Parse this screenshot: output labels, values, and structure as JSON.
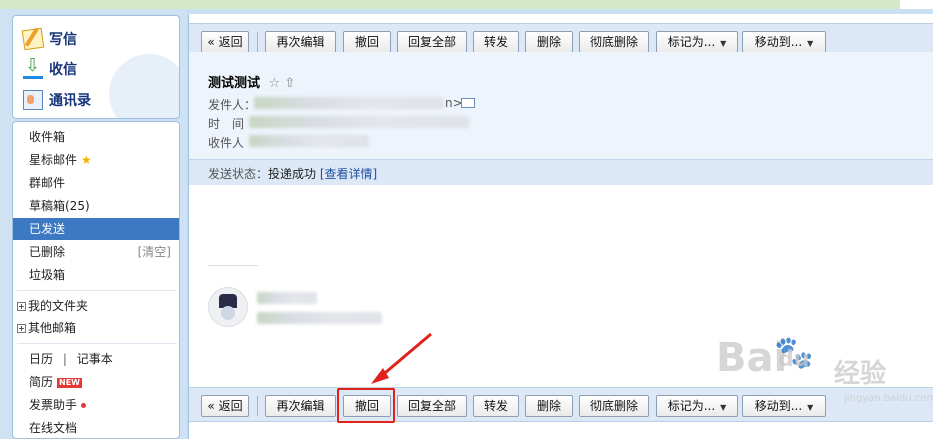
{
  "sidebar": {
    "compose": [
      {
        "label": "写信",
        "icon": "pencil-icon"
      },
      {
        "label": "收信",
        "icon": "inbox-download-icon"
      },
      {
        "label": "通讯录",
        "icon": "address-book-icon"
      }
    ],
    "folders": {
      "inbox": "收件箱",
      "starred": "星标邮件",
      "group": "群邮件",
      "drafts": "草稿箱(25)",
      "sent": "已发送",
      "deleted": "已删除",
      "deleted_action": "[清空]",
      "spam": "垃圾箱",
      "my_folders": "我的文件夹",
      "other_mailboxes": "其他邮箱",
      "calendar": "日历",
      "calendar_sep": "|",
      "notes": "记事本",
      "resume": "简历",
      "resume_badge": "NEW",
      "invoice": "发票助手",
      "online_docs": "在线文档"
    }
  },
  "toolbar": {
    "back": "« 返回",
    "reedit": "再次编辑",
    "recall": "撤回",
    "reply_all": "回复全部",
    "forward": "转发",
    "delete": "删除",
    "perm_delete": "彻底删除",
    "mark_as": "标记为...",
    "move_to": "移动到..."
  },
  "mail": {
    "subject": "测试测试",
    "subject_icons": "☆ ⇧",
    "from_label": "发件人：",
    "from_suffix": "n>",
    "time_label": "时　间",
    "to_label": "收件人",
    "status_label": "发送状态：",
    "status_value": "投递成功",
    "status_link": "[查看详情]"
  },
  "watermark": {
    "brand": "Bai",
    "brand2": "du",
    "jingyan": "经验",
    "url": "jingyan.baidu.com"
  },
  "colors": {
    "active_folder": "#3d78c3",
    "toolbar_bg": "#dce8f6",
    "highlight": "#e0221b"
  }
}
